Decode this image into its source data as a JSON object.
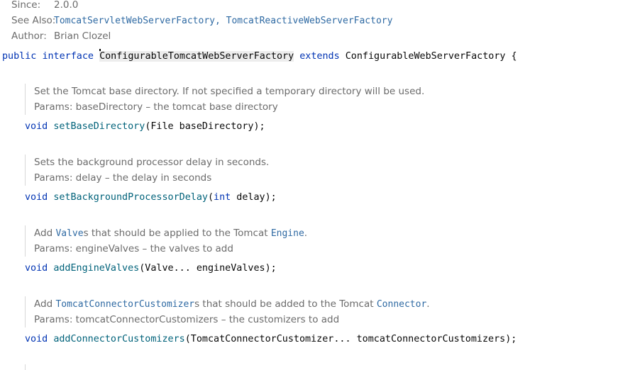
{
  "header_doc": {
    "since_label": "Since:",
    "since_value": "2.0.0",
    "see_also_label": "See Also:",
    "see_also_link1": "TomcatServletWebServerFactory",
    "see_also_sep": ", ",
    "see_also_link2": "TomcatReactiveWebServerFactory",
    "author_label": "Author:",
    "author_value": "Brian Clozel"
  },
  "declaration": {
    "kw_public": "public",
    "kw_interface": "interface",
    "name": "ConfigurableTomcatWebServerFactory",
    "kw_extends": "extends",
    "parent": "ConfigurableWebServerFactory",
    "brace": "{"
  },
  "methods": [
    {
      "doc_pre": "Set the Tomcat base directory. If not specified a temporary directory will be used.",
      "params": "Params: baseDirectory – the tomcat base directory",
      "return_type": "void",
      "name": "setBaseDirectory",
      "args": "(File baseDirectory);"
    },
    {
      "doc_pre": "Sets the background processor delay in seconds.",
      "params": "Params: delay – the delay in seconds",
      "return_type": "void",
      "name": "setBackgroundProcessorDelay",
      "args_open": "(",
      "args_kw": "int",
      "args_rest": " delay);"
    },
    {
      "doc_pre": "Add ",
      "doc_link1": "Valve",
      "doc_mid": "s that should be applied to the Tomcat ",
      "doc_link2": "Engine",
      "doc_post": ".",
      "params": "Params: engineValves – the valves to add",
      "return_type": "void",
      "name": "addEngineValves",
      "args": "(Valve... engineValves);"
    },
    {
      "doc_pre": "Add ",
      "doc_link1": "TomcatConnectorCustomizer",
      "doc_mid": "s that should be added to the Tomcat ",
      "doc_link2": "Connector",
      "doc_post": ".",
      "params": "Params: tomcatConnectorCustomizers – the customizers to add",
      "return_type": "void",
      "name": "addConnectorCustomizers",
      "args": "(TomcatConnectorCustomizer... tomcatConnectorCustomizers);"
    }
  ]
}
